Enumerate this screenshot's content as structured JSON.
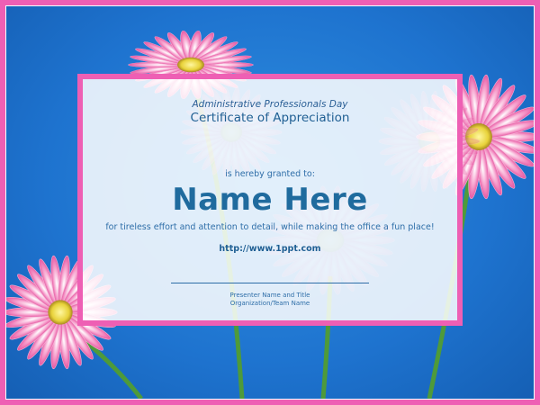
{
  "certificate": {
    "kicker": "Administrative Professionals Day",
    "title": "Certificate of Appreciation",
    "granted_text": "is hereby granted to:",
    "recipient_name": "Name Here",
    "reason": "for tireless effort and attention to detail, while making the office a fun place!",
    "url": "http://www.1ppt.com",
    "presenter_label": "Presenter Name and Title",
    "organization_label": "Organization/Team Name"
  },
  "colors": {
    "frame_pink": "#ee5fb4",
    "background_blue": "#1e73cf",
    "text_blue": "#1f6b9e"
  }
}
